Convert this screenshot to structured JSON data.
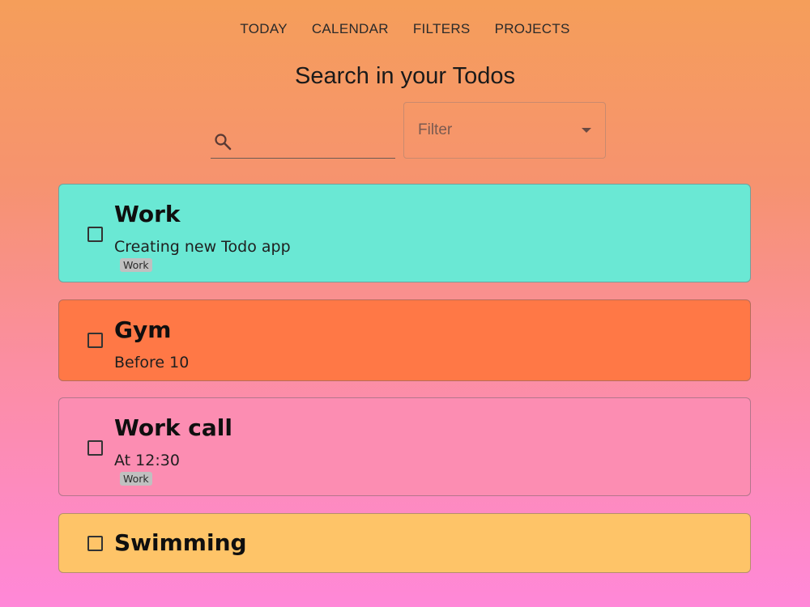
{
  "nav": {
    "items": [
      {
        "label": "TODAY"
      },
      {
        "label": "CALENDAR"
      },
      {
        "label": "FILTERS"
      },
      {
        "label": "PROJECTS"
      }
    ]
  },
  "page": {
    "title": "Search in your Todos"
  },
  "search": {
    "value": "",
    "icon": "search-icon"
  },
  "filter": {
    "label": "Filter",
    "icon": "dropdown-arrow-icon"
  },
  "todos": [
    {
      "title": "Work",
      "description": "Creating new Todo app",
      "tag": "Work",
      "color": "#6ae8d4",
      "checked": false
    },
    {
      "title": "Gym",
      "description": "Before 10",
      "tag": "",
      "color": "#ff7846",
      "checked": false
    },
    {
      "title": "Work call",
      "description": "At 12:30",
      "tag": "Work",
      "color": "#fc8db2",
      "checked": false
    },
    {
      "title": "Swimming",
      "description": "",
      "tag": "",
      "color": "#fec468",
      "checked": false
    }
  ]
}
